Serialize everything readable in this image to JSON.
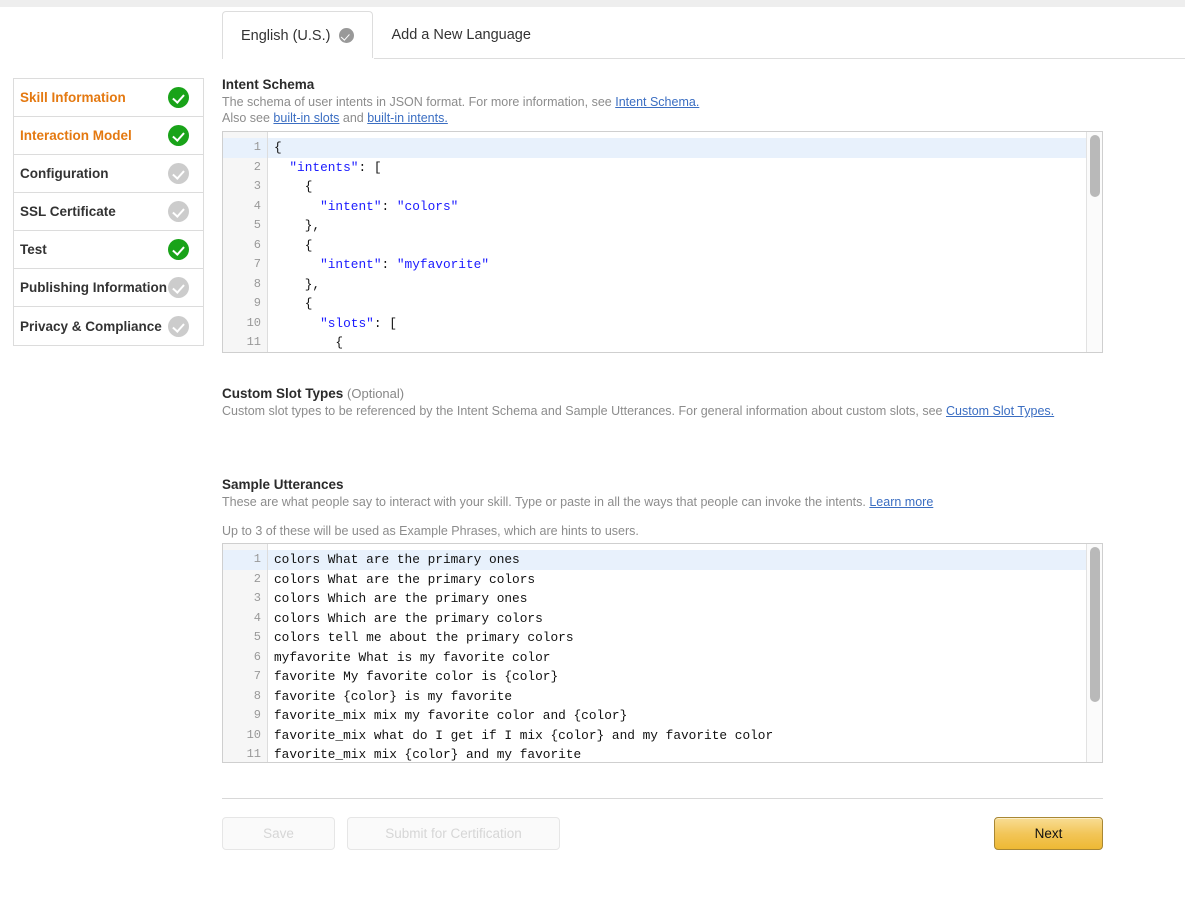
{
  "tabs": [
    {
      "label": "English (U.S.)",
      "has_check": true,
      "active": true
    },
    {
      "label": "Add a New Language",
      "has_check": false,
      "active": false
    }
  ],
  "sidebar": {
    "items": [
      {
        "label": "Skill Information",
        "state": "done"
      },
      {
        "label": "Interaction Model",
        "state": "done"
      },
      {
        "label": "Configuration",
        "state": "pending"
      },
      {
        "label": "SSL Certificate",
        "state": "pending"
      },
      {
        "label": "Test",
        "state": "done"
      },
      {
        "label": "Publishing Information",
        "state": "pending"
      },
      {
        "label": "Privacy & Compliance",
        "state": "pending"
      }
    ]
  },
  "intent_schema": {
    "title": "Intent Schema",
    "desc_part1": "The schema of user intents in JSON format. For more information, see ",
    "desc_link1": "Intent Schema.",
    "desc_part2": "Also see ",
    "desc_link2": "built-in slots",
    "desc_part3": " and ",
    "desc_link3": "built-in intents.",
    "lines": [
      {
        "n": "1",
        "text": "{"
      },
      {
        "n": "2",
        "text": "  \"intents\": ["
      },
      {
        "n": "3",
        "text": "    {"
      },
      {
        "n": "4",
        "text": "      \"intent\": \"colors\""
      },
      {
        "n": "5",
        "text": "    },"
      },
      {
        "n": "6",
        "text": "    {"
      },
      {
        "n": "7",
        "text": "      \"intent\": \"myfavorite\""
      },
      {
        "n": "8",
        "text": "    },"
      },
      {
        "n": "9",
        "text": "    {"
      },
      {
        "n": "10",
        "text": "      \"slots\": ["
      },
      {
        "n": "11",
        "text": "        {"
      }
    ]
  },
  "custom_slot_types": {
    "title": "Custom Slot Types",
    "optional": "(Optional)",
    "desc_part1": "Custom slot types to be referenced by the Intent Schema and Sample Utterances. For general information about custom slots, see ",
    "desc_link": "Custom Slot Types."
  },
  "sample_utterances": {
    "title": "Sample Utterances",
    "desc_part1": "These are what people say to interact with your skill. Type or paste in all the ways that people can invoke the intents. ",
    "desc_link": "Learn more",
    "note": "Up to 3 of these will be used as Example Phrases, which are hints to users.",
    "lines": [
      {
        "n": "1",
        "text": "colors What are the primary ones"
      },
      {
        "n": "2",
        "text": "colors What are the primary colors"
      },
      {
        "n": "3",
        "text": "colors Which are the primary ones"
      },
      {
        "n": "4",
        "text": "colors Which are the primary colors"
      },
      {
        "n": "5",
        "text": "colors tell me about the primary colors"
      },
      {
        "n": "6",
        "text": "myfavorite What is my favorite color"
      },
      {
        "n": "7",
        "text": "favorite My favorite color is {color}"
      },
      {
        "n": "8",
        "text": "favorite {color} is my favorite"
      },
      {
        "n": "9",
        "text": "favorite_mix mix my favorite color and {color}"
      },
      {
        "n": "10",
        "text": "favorite_mix what do I get if I mix {color} and my favorite color"
      },
      {
        "n": "11",
        "text": "favorite_mix mix {color} and my favorite"
      }
    ]
  },
  "footer": {
    "save": "Save",
    "submit": "Submit for Certification",
    "next": "Next"
  },
  "colors": {
    "accent_orange": "#e47911",
    "check_green": "#19a319",
    "check_gray": "#cccccc",
    "link_blue": "#3b6ec2",
    "code_blue": "#1a1aff",
    "next_gold": "#f2c557"
  }
}
